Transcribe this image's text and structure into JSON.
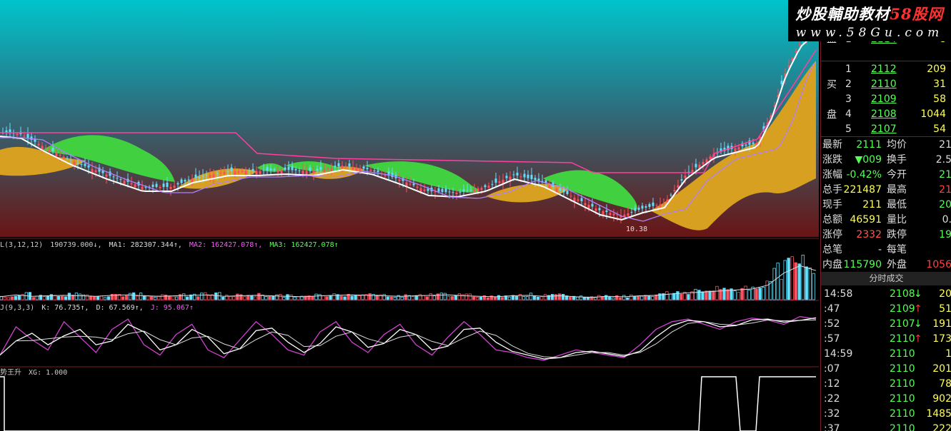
{
  "watermark": {
    "line1a": "炒股輔助教材",
    "line1b": "58股网",
    "line2": "www.58Gu.com"
  },
  "main_chart": {
    "low_mark": "10.38"
  },
  "vol_header": {
    "prefix": "L(3,12,12)",
    "vol": "190739.000↓,",
    "ma1": "MA1: 282307.344↑,",
    "ma2": "MA2: 162427.078↑,",
    "ma3": "MA3: 162427.078↑"
  },
  "kdj_header": {
    "prefix": "J(9,3,3)",
    "k": "K: 76.735↑,",
    "d": "D: 67.569↑,",
    "j": "J: 95.067↑"
  },
  "xg_header": {
    "prefix": "势王升",
    "xg": "XG: 1.000"
  },
  "chart_data": [
    {
      "type": "line",
      "series": [
        {
          "values": [
            4,
            6,
            8,
            9,
            9,
            8,
            7,
            8,
            10,
            11,
            12,
            10,
            9,
            9,
            9,
            8,
            7,
            6,
            6,
            7,
            8,
            9,
            10,
            10,
            9,
            8,
            9,
            10,
            10,
            9,
            7,
            8,
            9,
            8,
            6,
            5,
            5,
            4,
            3,
            2,
            3,
            5,
            8,
            9,
            11,
            14,
            16,
            18,
            20,
            40,
            62,
            82
          ]
        },
        {
          "values": [
            0.06,
            0.1,
            0.07,
            0.08,
            0.09,
            0.08,
            0.07,
            0.09,
            0.1,
            0.08,
            0.07,
            0.08,
            0.09,
            0.1,
            0.07,
            0.08,
            0.09,
            0.08,
            0.07,
            0.06,
            0.08,
            0.09,
            0.1,
            0.09,
            0.08,
            0.07,
            0.08,
            0.09,
            0.1,
            0.08,
            0.07,
            0.06,
            0.08,
            0.09,
            0.07,
            0.08,
            0.06,
            0.05,
            0.07,
            0.06,
            0.08,
            0.09,
            0.12,
            0.14,
            0.16,
            0.18,
            0.2,
            0.22,
            0.3,
            0.55,
            0.7,
            0.6
          ]
        },
        {
          "values": [
            20,
            75,
            50,
            30,
            85,
            55,
            25,
            70,
            90,
            40,
            20,
            60,
            80,
            30,
            15,
            50,
            85,
            60,
            30,
            20,
            65,
            85,
            45,
            25,
            60,
            80,
            40,
            20,
            55,
            85,
            60,
            30,
            25,
            15,
            10,
            20,
            30,
            25,
            20,
            15,
            40,
            70,
            85,
            90,
            80,
            70,
            85,
            92,
            88,
            80,
            95,
            90
          ]
        }
      ],
      "ylim": [
        0,
        100
      ]
    }
  ],
  "quote": {
    "sell_label": "盘",
    "sell_rows": [
      {
        "n": "1",
        "p": "2114",
        "v": "8"
      }
    ],
    "buy_label_1": "买",
    "buy_label_2": "盘",
    "buy_rows": [
      {
        "n": "1",
        "p": "2112",
        "v": "209"
      },
      {
        "n": "2",
        "p": "2110",
        "v": "31"
      },
      {
        "n": "3",
        "p": "2109",
        "v": "58"
      },
      {
        "n": "4",
        "p": "2108",
        "v": "1044"
      },
      {
        "n": "5",
        "p": "2107",
        "v": "54"
      }
    ],
    "stats": [
      {
        "l1": "最新",
        "v1": "2111",
        "l2": "均价",
        "v2": "21"
      },
      {
        "l1": "涨跌",
        "v1": "▼009",
        "l2": "换手",
        "v2": "2.5"
      },
      {
        "l1": "涨幅",
        "v1": "-0.42%",
        "l2": "今开",
        "v2": "21"
      },
      {
        "l1": "总手",
        "v1": "221487",
        "l2": "最高",
        "v2": "21"
      },
      {
        "l1": "现手",
        "v1": "211",
        "l2": "最低",
        "v2": "20"
      },
      {
        "l1": "总额",
        "v1": "46591",
        "l2": "量比",
        "v2": "0."
      },
      {
        "l1": "涨停",
        "v1": "2332",
        "l2": "跌停",
        "v2": "19"
      },
      {
        "l1": "总笔",
        "v1": "-",
        "l2": "每笔",
        "v2": ""
      },
      {
        "l1": "内盘",
        "v1": "115790",
        "l2": "外盘",
        "v2": "1056"
      }
    ],
    "ticks_header": "分时成交",
    "ticks": [
      {
        "t": "14:58",
        "p": "2108",
        "a": "↓",
        "v": "20"
      },
      {
        "t": ":47",
        "p": "2109",
        "a": "↑",
        "v": "51"
      },
      {
        "t": ":52",
        "p": "2107",
        "a": "↓",
        "v": "191"
      },
      {
        "t": ":57",
        "p": "2110",
        "a": "↑",
        "v": "173"
      },
      {
        "t": "14:59",
        "p": "2110",
        "a": "",
        "v": "1"
      },
      {
        "t": ":07",
        "p": "2110",
        "a": "",
        "v": "201"
      },
      {
        "t": ":12",
        "p": "2110",
        "a": "",
        "v": "78"
      },
      {
        "t": ":22",
        "p": "2110",
        "a": "",
        "v": "902"
      },
      {
        "t": ":32",
        "p": "2110",
        "a": "",
        "v": "1485"
      },
      {
        "t": ":37",
        "p": "2110",
        "a": "",
        "v": "222"
      }
    ]
  }
}
